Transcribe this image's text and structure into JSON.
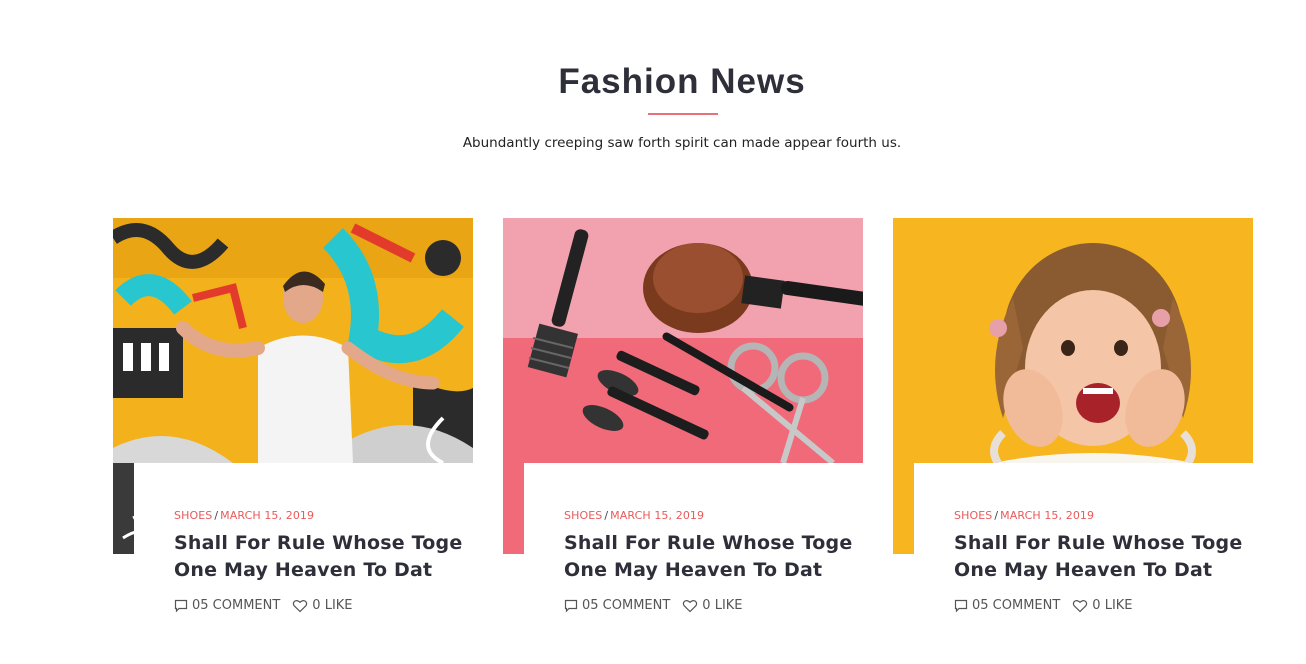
{
  "section": {
    "title": "Fashion News",
    "subtitle": "Abundantly creeping saw forth spirit can made appear fourth us.",
    "accent_color": "#e8727a"
  },
  "cards": [
    {
      "image_desc": "man-graffiti-wall",
      "category": "SHOES",
      "separator": "/",
      "date": "MARCH 15, 2019",
      "title": "Shall For Rule Whose Toge One May Heaven To Dat",
      "comments": "05 COMMENT",
      "likes": "0 LIKE"
    },
    {
      "image_desc": "makeup-tools-pink",
      "category": "SHOES",
      "separator": "/",
      "date": "MARCH 15, 2019",
      "title": "Shall For Rule Whose Toge One May Heaven To Dat",
      "comments": "05 COMMENT",
      "likes": "0 LIKE"
    },
    {
      "image_desc": "happy-girl-yellow",
      "category": "SHOES",
      "separator": "/",
      "date": "MARCH 15, 2019",
      "title": "Shall For Rule Whose Toge One May Heaven To Dat",
      "comments": "05 COMMENT",
      "likes": "0 LIKE"
    }
  ],
  "colors": {
    "meta_accent": "#e85a5a",
    "heading": "#2f2f3a"
  }
}
